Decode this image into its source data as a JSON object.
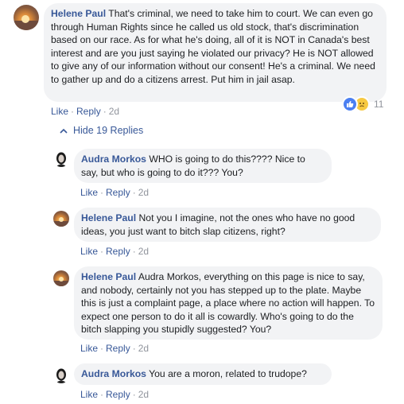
{
  "comments": [
    {
      "author": "Helene Paul",
      "text": "That's criminal, we need to take him to court. We can even go through Human Rights since he called us old stock, that's discrimination based on our race. As for what he's doing, all of it is NOT in Canada's best interest and are you just saying he violated our privacy? He is NOT allowed to give any of our information without our consent! He's a criminal. We need to gather up and do a citizens arrest. Put him in jail asap.",
      "like": "Like",
      "reply": "Reply",
      "time": "2d",
      "reaction_count": "11"
    }
  ],
  "hide_replies": "Hide 19 Replies",
  "replies": [
    {
      "author": "Audra Morkos",
      "text": "WHO is going to do this???? Nice to say, but who is going to do it??? You?",
      "like": "Like",
      "reply": "Reply",
      "time": "2d"
    },
    {
      "author": "Helene Paul",
      "text": "Not you I imagine, not the ones who have no good ideas, you just want to bitch slap citizens, right?",
      "like": "Like",
      "reply": "Reply",
      "time": "2d"
    },
    {
      "author": "Helene Paul",
      "text": "Audra Morkos, everything on this page is nice to say, and nobody, certainly not you has stepped up to the plate. Maybe this is just a complaint page, a place where no action will happen. To expect one person to do it all is cowardly. Who's going to do the bitch slapping you stupidly suggested? You?",
      "like": "Like",
      "reply": "Reply",
      "time": "2d"
    },
    {
      "author": "Audra Morkos",
      "text": "You are a moron, related to trudope?",
      "like": "Like",
      "reply": "Reply",
      "time": "2d"
    }
  ],
  "colors": {
    "link": "#385898",
    "bubble": "#f2f3f5",
    "meta": "#90949c",
    "like_reaction": "#4b7ff1",
    "sad_reaction": "#f7c942"
  },
  "icons": {
    "top_avatar": "sunset-photo-avatar",
    "reply_avatar_helene": "sunset-photo-avatar",
    "reply_avatar_audra": "person-silhouette-avatar",
    "hide_chevron": "chevron-up-icon",
    "reactions": [
      "like-icon",
      "sad-icon"
    ]
  }
}
